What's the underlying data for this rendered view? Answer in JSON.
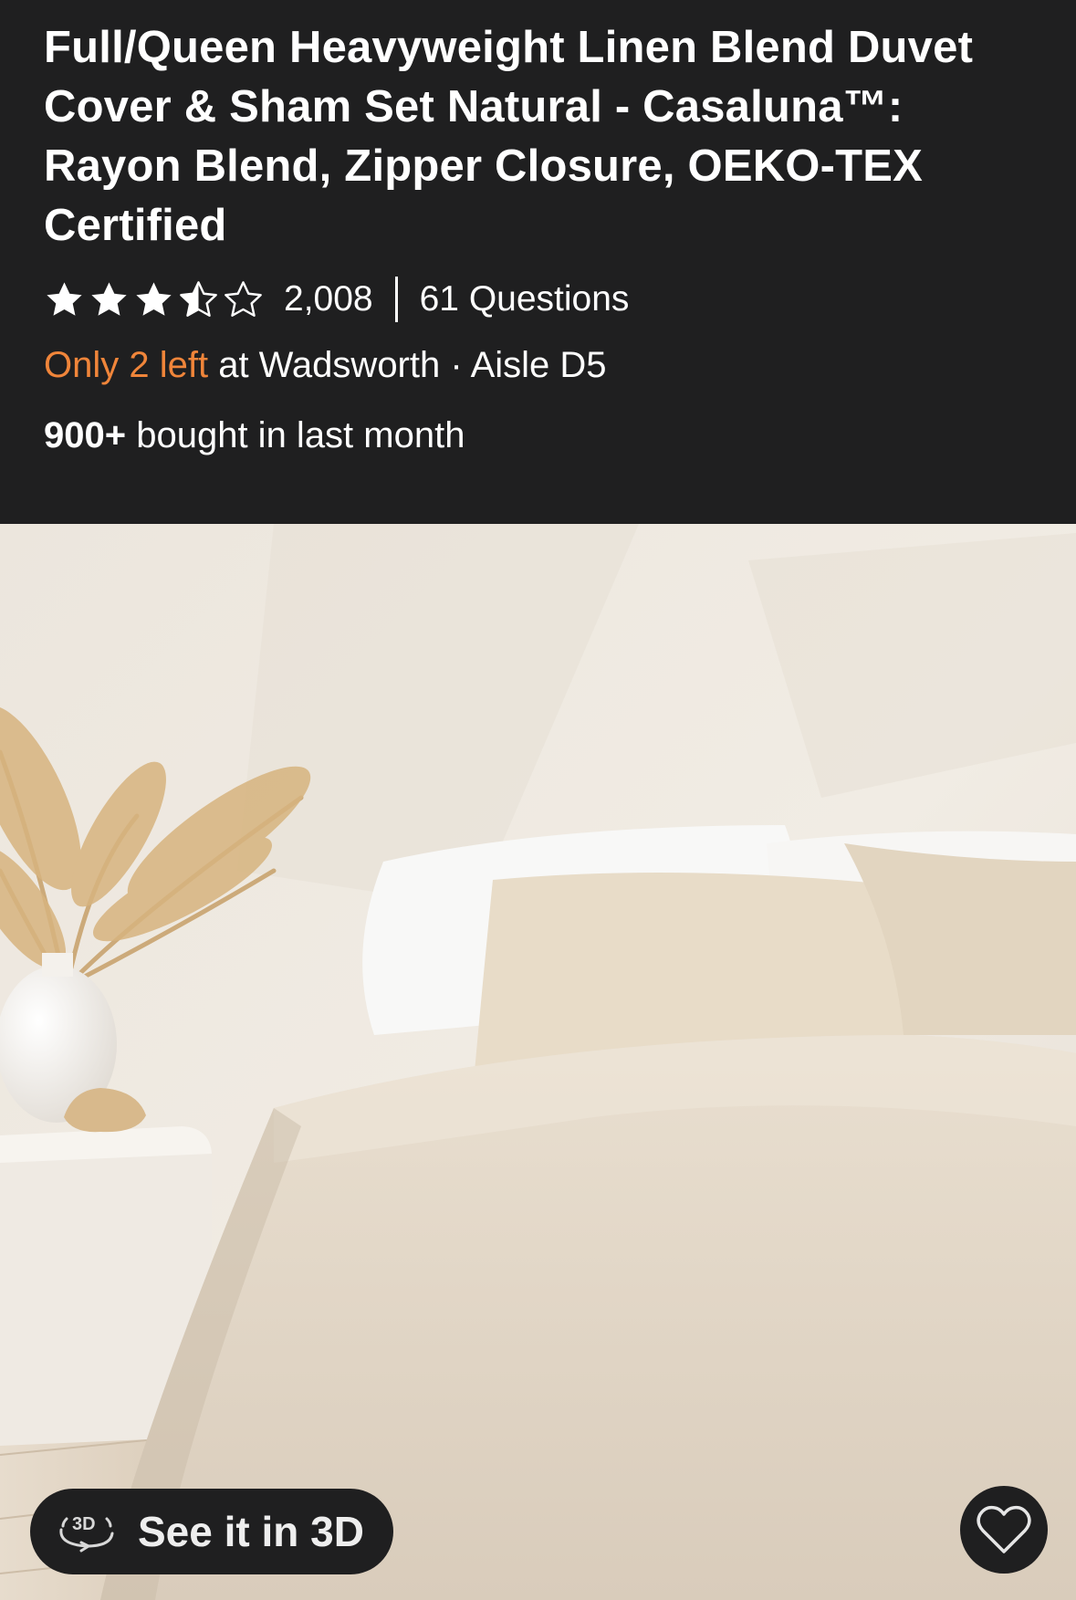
{
  "product": {
    "title": "Full/Queen Heavyweight Linen Blend Duvet Cover & Sham Set Natural - Casaluna™: Rayon Blend, Zipper Closure, OEKO-TEX Certified",
    "rating": {
      "stars": 3.5,
      "max_stars": 5,
      "review_count": "2,008",
      "questions_label": "61 Questions"
    },
    "availability": {
      "urgent_text": "Only 2 left",
      "location_text": " at Wadsworth · Aisle D5"
    },
    "social_proof": {
      "count": "900+",
      "text": " bought in last month"
    }
  },
  "image_actions": {
    "see_3d_icon_text": "3D",
    "see_3d_label": "See it in 3D",
    "favorite_icon": "heart-outline-icon"
  },
  "colors": {
    "header_bg": "#1f1f20",
    "urgent": "#f0853a",
    "text": "#ffffff"
  }
}
